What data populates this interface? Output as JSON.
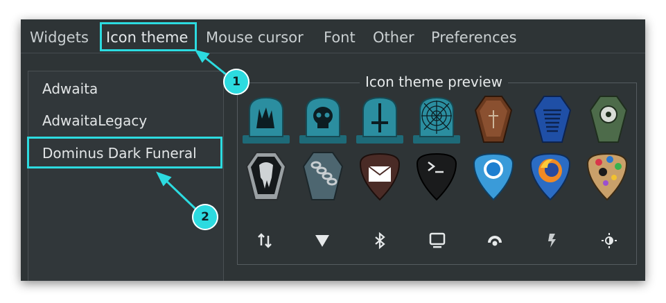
{
  "tabs": [
    "Widgets",
    "Icon theme",
    "Mouse cursor",
    "Font",
    "Other",
    "Preferences"
  ],
  "themes": [
    "Adwaita",
    "AdwaitaLegacy",
    "Dominus Dark Funeral"
  ],
  "preview_title": "Icon theme preview",
  "icons_row1": [
    "tombstone-horns-icon",
    "tombstone-skull-icon",
    "tombstone-cross-icon",
    "tombstone-web-icon",
    "coffin-wood-icon",
    "coffin-blue-icon",
    "coffin-sawblade-icon"
  ],
  "icons_row2": [
    "coffin-silver-icon",
    "coffin-chain-icon",
    "pick-mail-icon",
    "pick-terminal-icon",
    "pick-chromium-icon",
    "pick-firefox-icon",
    "pick-paint-icon"
  ],
  "symbolic_icons": [
    "network-transfer-icon",
    "wifi-triangle-icon",
    "bluetooth-icon",
    "display-icon",
    "wireless-icon",
    "power-flash-icon",
    "brightness-icon"
  ],
  "annotations": [
    "1",
    "2"
  ],
  "accent_color": "#2cdbe0"
}
